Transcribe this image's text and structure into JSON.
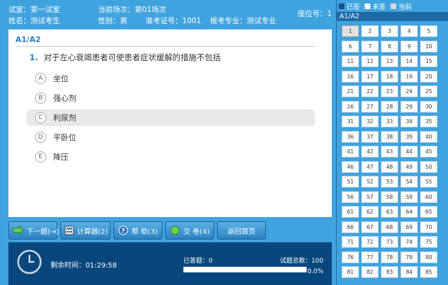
{
  "header": {
    "room": "试室：第一试室",
    "session": "当前场次：第01场次",
    "name": "姓名：测试考生",
    "gender": "性别：男",
    "exam_no": "准考证号：1001",
    "major": "报考专业：测试专业",
    "seat": "座位号：1"
  },
  "question": {
    "section": "A1/A2",
    "number": "1.",
    "text": "对于左心衰竭患者可使患者症状缓解的措施不包括",
    "options": [
      {
        "letter": "A",
        "text": "坐位"
      },
      {
        "letter": "B",
        "text": "强心剂"
      },
      {
        "letter": "C",
        "text": "利尿剂"
      },
      {
        "letter": "D",
        "text": "平卧位"
      },
      {
        "letter": "E",
        "text": "降压"
      }
    ],
    "selected_letter": "C"
  },
  "toolbar": {
    "next": "下一题(→)",
    "calculator": "计算器(2)",
    "help": "帮 助(3)",
    "submit": "交 卷(4)",
    "home": "返回首页"
  },
  "footer": {
    "remaining": "剩余时间：01:29:58",
    "answered": "已答题：0",
    "total": "试题总数：100",
    "percent_text": "0.0%",
    "progress_fraction": 0.0
  },
  "right_panel": {
    "legend": {
      "answered": "已答",
      "unanswered": "未答",
      "current": "当前"
    },
    "title": "A1/A2",
    "current_number": 1,
    "numbers": [
      1,
      2,
      3,
      4,
      5,
      6,
      7,
      8,
      9,
      10,
      11,
      12,
      13,
      14,
      15,
      16,
      17,
      18,
      19,
      20,
      21,
      22,
      23,
      24,
      25,
      26,
      27,
      28,
      29,
      30,
      31,
      32,
      33,
      34,
      35,
      36,
      37,
      38,
      39,
      40,
      41,
      42,
      43,
      44,
      45,
      46,
      47,
      48,
      49,
      50,
      51,
      52,
      53,
      54,
      55,
      56,
      57,
      58,
      59,
      60,
      61,
      62,
      63,
      64,
      65,
      66,
      67,
      68,
      69,
      70,
      71,
      72,
      73,
      74,
      75,
      76,
      77,
      78,
      79,
      80,
      81,
      82,
      83,
      84,
      85
    ]
  },
  "colors": {
    "background_blue": "#3fa3df",
    "footer_navy": "#07477d",
    "accent_blue": "#2a7fc4",
    "legend_answered": "#1d4f8a",
    "legend_unanswered": "#ffffff",
    "legend_current": "#d8d8d8"
  }
}
